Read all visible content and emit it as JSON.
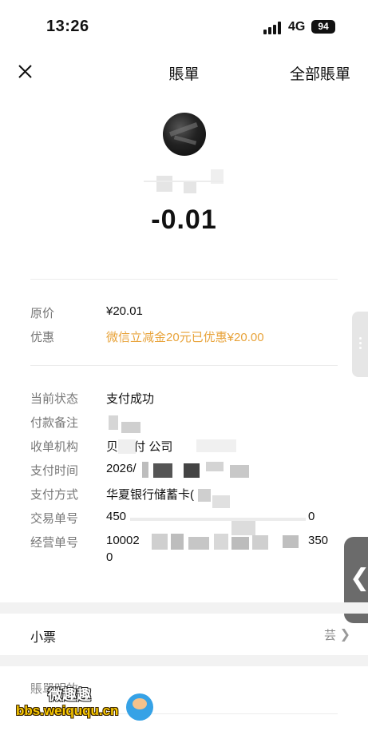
{
  "status_bar": {
    "time": "13:26",
    "network": "4G",
    "battery": "94"
  },
  "nav": {
    "title": "賬單",
    "all_bills": "全部賬單"
  },
  "amount": "-0.01",
  "price_section": {
    "original_price_label": "原价",
    "original_price_value": "¥20.01",
    "discount_label": "优惠",
    "discount_value": "微信立减金20元已优惠¥20.00",
    "discount_color": "#e8a33a"
  },
  "details": [
    {
      "label": "当前状态",
      "value": "支付成功"
    },
    {
      "label": "付款备注",
      "value": ""
    },
    {
      "label": "收单机构",
      "value": "贝      支付          公司"
    },
    {
      "label": "支付时间",
      "value": "2026/"
    },
    {
      "label": "支付方式",
      "value": "华夏银行储蓄卡("
    },
    {
      "label": "交易单号",
      "value": "450",
      "value_end": "0"
    },
    {
      "label": "经营单号",
      "value": "10002",
      "value_end": "350",
      "value_line2": "0"
    }
  ],
  "receipt": {
    "label": "小票",
    "value": "芸"
  },
  "bill_detail_label": "賬單明敀",
  "watermark": {
    "site": "bbs.weiququ.cn",
    "brand": "微趣趣"
  },
  "icons": {
    "close": "close-icon",
    "chevron": "chevron-right-icon",
    "collapse": "chevron-left-icon",
    "signal": "signal-icon",
    "battery": "battery-icon"
  }
}
